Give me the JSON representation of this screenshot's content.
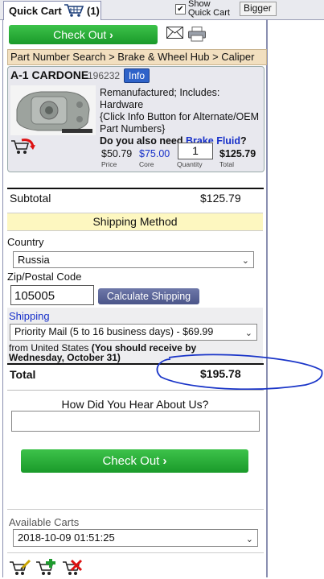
{
  "tab": {
    "label": "Quick Cart",
    "count": "(1)"
  },
  "show_quick_cart": {
    "line1": "Show",
    "line2": "Quick Cart",
    "checked": "✔"
  },
  "bigger_label": "Bigger",
  "checkout_label": "Check Out",
  "breadcrumb": "Part Number Search > Brake & Wheel Hub > Caliper",
  "item": {
    "brand": "A-1 CARDONE",
    "part_number": "196232",
    "info_label": "Info",
    "desc_line1": "Remanufactured; Includes: Hardware",
    "desc_line2": "{Click Info Button for Alternate/OEM",
    "desc_line3": "Part Numbers}",
    "question_prefix": "Do you also need ",
    "question_link": "Brake Fluid",
    "question_suffix": "?",
    "price": "$50.79",
    "price_label": "Price",
    "core": "$75.00",
    "core_label": "Core",
    "quantity": "1",
    "quantity_label": "Quantity",
    "total": "$125.79",
    "total_label": "Total"
  },
  "subtotal": {
    "label": "Subtotal",
    "value": "$125.79"
  },
  "shipping_method_title": "Shipping Method",
  "country": {
    "label": "Country",
    "value": "Russia"
  },
  "zip": {
    "label": "Zip/Postal Code",
    "value": "105005",
    "button": "Calculate Shipping"
  },
  "shipping": {
    "label": "Shipping",
    "value": "Priority Mail (5 to 16 business days) - $69.99",
    "from_prefix": "from United States ",
    "from_bold1": "(You should receive by",
    "from_bold2": "Wednesday, October 31)"
  },
  "total": {
    "label": "Total",
    "value": "$195.78"
  },
  "hear_about": {
    "label": "How Did You Hear About Us?",
    "value": ""
  },
  "available_carts": {
    "label": "Available Carts",
    "value": "2018-10-09 01:51:25"
  },
  "colors": {
    "accent_green": "#1a9a2a",
    "link_blue": "#1730c9",
    "info_blue": "#2f63c9",
    "ink_blue": "#1a35c8"
  }
}
